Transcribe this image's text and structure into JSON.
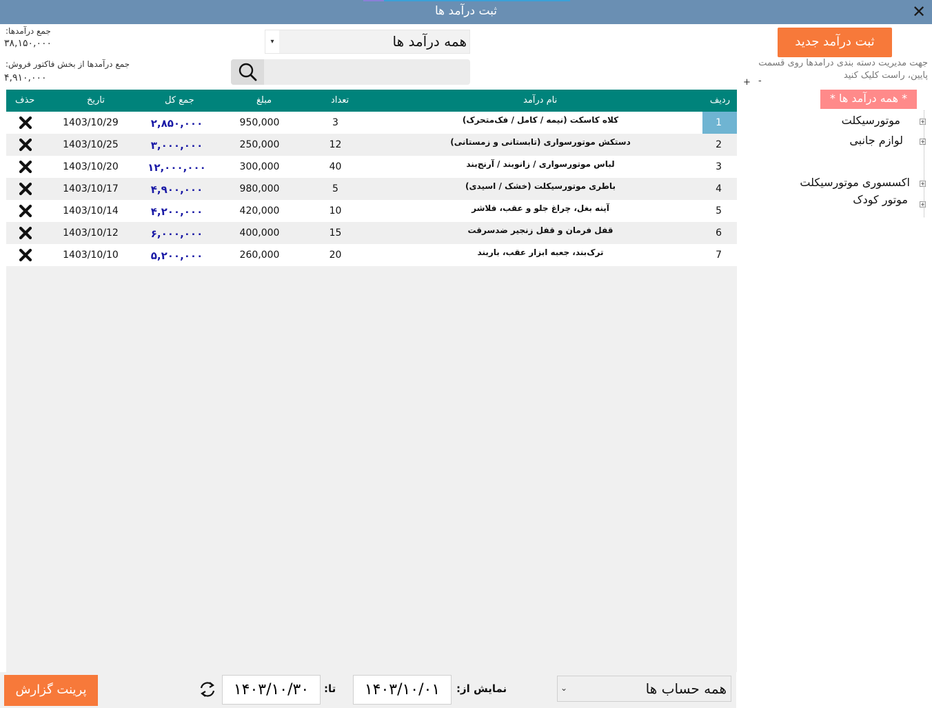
{
  "window": {
    "title": "ثبت درآمد ها",
    "close_glyph": "✕"
  },
  "summary": {
    "total_label": "جمع درآمدها:",
    "total_value": "۳۸,۱۵۰,۰۰۰",
    "sales_label": "جمع درآمدها از بخش فاکتور فروش:",
    "sales_value": "۴,۹۱۰,۰۰۰"
  },
  "filter": {
    "selected": "همه درآمد ها",
    "arrow": "▾"
  },
  "search": {
    "placeholder": "",
    "icon": "search-icon"
  },
  "actions": {
    "new_income_label": "ثبت درآمد جدید"
  },
  "hint": "جهت مدیریت دسته بندی درامدها روی قسمت پایین، راست کلیک کنید",
  "tree": {
    "plus": "+",
    "minus": "-",
    "all_label": "* همه درآمد ها *",
    "expander": "+",
    "items": [
      "موتورسیکلت",
      "لوازم جانبی",
      "اکسسوری موتورسیکلت",
      "موتور کودک"
    ]
  },
  "table": {
    "headers": {
      "row": "ردیف",
      "name": "نام درآمد",
      "count": "تعداد",
      "amount": "مبلغ",
      "total": "جمع کل",
      "date": "تاریخ",
      "delete": "حذف"
    },
    "rows": [
      {
        "row": "1",
        "name": "کلاه کاسکت (نیمه / کامل / فک‌متحرک)",
        "count": "3",
        "amount": "950,000",
        "total": "۲,۸۵۰,۰۰۰",
        "date": "1403/10/29"
      },
      {
        "row": "2",
        "name": "دستکش موتورسواری (تابستانی و زمستانی)",
        "count": "12",
        "amount": "250,000",
        "total": "۳,۰۰۰,۰۰۰",
        "date": "1403/10/25"
      },
      {
        "row": "3",
        "name": "لباس موتورسواری / زانوبند / آرنج‌بند",
        "count": "40",
        "amount": "300,000",
        "total": "۱۲,۰۰۰,۰۰۰",
        "date": "1403/10/20"
      },
      {
        "row": "4",
        "name": "باطری موتورسیکلت (خشک / اسیدی)",
        "count": "5",
        "amount": "980,000",
        "total": "۴,۹۰۰,۰۰۰",
        "date": "1403/10/17"
      },
      {
        "row": "5",
        "name": "آینه بغل، چراغ جلو و عقب، فلاشر",
        "count": "10",
        "amount": "420,000",
        "total": "۴,۲۰۰,۰۰۰",
        "date": "1403/10/14"
      },
      {
        "row": "6",
        "name": "قفل فرمان و قفل زنجیر ضدسرقت",
        "count": "15",
        "amount": "400,000",
        "total": "۶,۰۰۰,۰۰۰",
        "date": "1403/10/12"
      },
      {
        "row": "7",
        "name": "ترک‌بند، جعبه ابزار عقب، باربند",
        "count": "20",
        "amount": "260,000",
        "total": "۵,۲۰۰,۰۰۰",
        "date": "1403/10/10"
      }
    ]
  },
  "footer": {
    "print_label": "پرینت گزارش",
    "to_label": "تا:",
    "to_date": "۱۴۰۳/۱۰/۳۰",
    "from_label": "نمایش از:",
    "from_date": "۱۴۰۳/۱۰/۰۱",
    "account_selected": "همه حساب ها",
    "account_arrow": "⌄"
  },
  "colors": {
    "titlebar": "#6a8fb3",
    "header": "#00837b",
    "accent_button": "#f7793a",
    "tree_all": "#ff8a8a",
    "selected_row": "#6fb4d2",
    "total_text": "#1a1aa6"
  }
}
